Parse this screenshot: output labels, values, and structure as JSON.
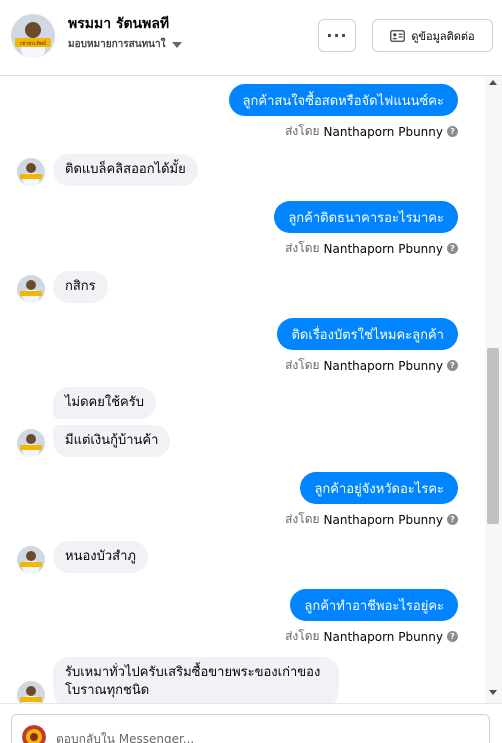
{
  "header": {
    "name": "พรมมา รัตนพลที",
    "assignee": "มอบหมายการสนทนาใ",
    "avatar_badge": "เช่าพระทิพย์",
    "more_label": "···",
    "contact_button_label": "ดูข้อมูลติดต่อ"
  },
  "messages": {
    "m1": "ลูกค้าสนใจซื้อสดหรือจัดไฟแนนซ์คะ",
    "m1_sent_prefix": "ส่งโดย",
    "m1_sender": "Nanthaporn Pbunny",
    "m2": "ติดแบล็คลิสออกได้มั้ย",
    "m3": "ลูกค้าติดธนาคารอะไรมาคะ",
    "m3_sent_prefix": "ส่งโดย",
    "m3_sender": "Nanthaporn Pbunny",
    "m4": "กสิกร",
    "m5": "ติดเรื่องบัตรใช่ไหมคะลูกค้า",
    "m5_sent_prefix": "ส่งโดย",
    "m5_sender": "Nanthaporn Pbunny",
    "m6": "ไม่ดคยใช้ครับ",
    "m7": "มีแต่เงินกู้บ้านค้า",
    "m8": "ลูกค้าอยู่จังหวัดอะไรคะ",
    "m8_sent_prefix": "ส่งโดย",
    "m8_sender": "Nanthaporn Pbunny",
    "m9": "หนองบัวสำภู",
    "m10": "ลูกค้าทำอาชีพอะไรอยู่คะ",
    "m10_sent_prefix": "ส่งโดย",
    "m10_sender": "Nanthaporn Pbunny",
    "m11": "รับเหมาทั่วไปครับเสริมซื้อขายพระของเก่าของโบราณทุกชนิด"
  },
  "composer": {
    "placeholder": "ตอบกลับใน Messenger..."
  },
  "colors": {
    "outgoing_bubble": "#0084ff",
    "incoming_bubble": "#f0f2f5",
    "muted_text": "#65676b"
  }
}
